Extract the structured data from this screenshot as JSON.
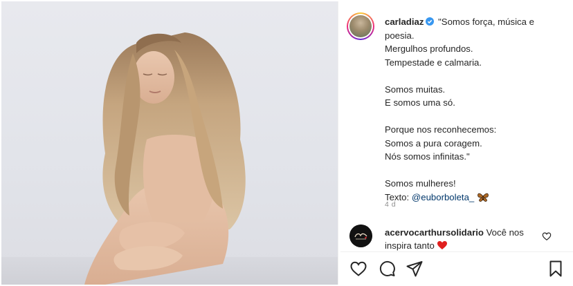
{
  "post": {
    "username": "carladiaz",
    "verified": true,
    "caption_lines": [
      "\"Somos força, música e",
      "poesia.",
      "Mergulhos profundos.",
      "Tempestade e calmaria.",
      "",
      "Somos muitas.",
      "E somos uma só.",
      "",
      "Porque nos reconhecemos:",
      "Somos a pura coragem.",
      "Nós somos infinitas.\"",
      "",
      "Somos mulheres!"
    ],
    "credit_prefix": "Texto: ",
    "credit_mention": "@euborboleta_",
    "credit_emoji": "butterfly-emoji",
    "timestamp": "4 d"
  },
  "comment": {
    "username": "acervocarthursolidario",
    "text": "Você nos inspira tanto",
    "emoji": "red-heart-emoji"
  },
  "actions": {
    "like_icon": "heart-icon",
    "comment_icon": "comment-icon",
    "share_icon": "share-icon",
    "save_icon": "bookmark-icon"
  },
  "colors": {
    "text": "#262626",
    "secondary": "#8e8e8e",
    "mention": "#00376b",
    "verified": "#3897f0",
    "heart_red": "#ed4956"
  }
}
